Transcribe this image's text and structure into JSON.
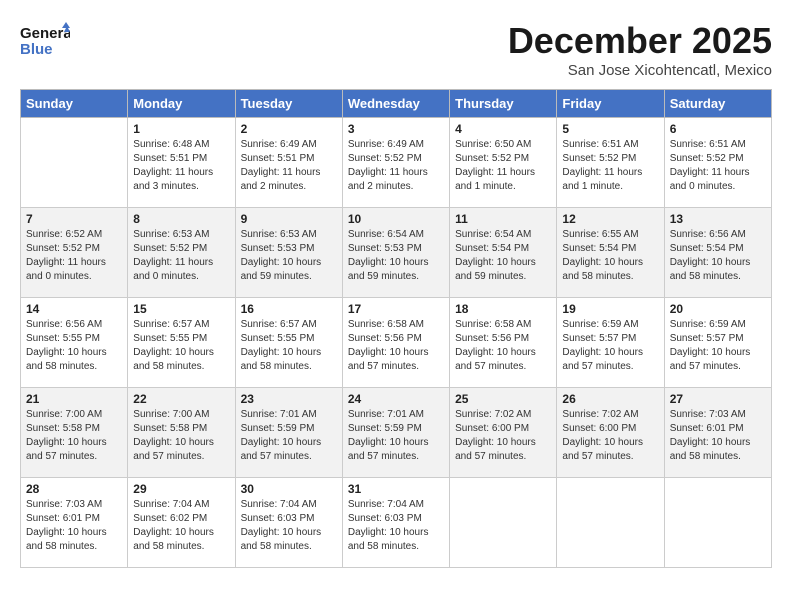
{
  "header": {
    "logo_line1": "General",
    "logo_line2": "Blue",
    "month": "December 2025",
    "location": "San Jose Xicohtencatl, Mexico"
  },
  "weekdays": [
    "Sunday",
    "Monday",
    "Tuesday",
    "Wednesday",
    "Thursday",
    "Friday",
    "Saturday"
  ],
  "weeks": [
    [
      {
        "day": "",
        "sunrise": "",
        "sunset": "",
        "daylight": ""
      },
      {
        "day": "1",
        "sunrise": "Sunrise: 6:48 AM",
        "sunset": "Sunset: 5:51 PM",
        "daylight": "Daylight: 11 hours and 3 minutes."
      },
      {
        "day": "2",
        "sunrise": "Sunrise: 6:49 AM",
        "sunset": "Sunset: 5:51 PM",
        "daylight": "Daylight: 11 hours and 2 minutes."
      },
      {
        "day": "3",
        "sunrise": "Sunrise: 6:49 AM",
        "sunset": "Sunset: 5:52 PM",
        "daylight": "Daylight: 11 hours and 2 minutes."
      },
      {
        "day": "4",
        "sunrise": "Sunrise: 6:50 AM",
        "sunset": "Sunset: 5:52 PM",
        "daylight": "Daylight: 11 hours and 1 minute."
      },
      {
        "day": "5",
        "sunrise": "Sunrise: 6:51 AM",
        "sunset": "Sunset: 5:52 PM",
        "daylight": "Daylight: 11 hours and 1 minute."
      },
      {
        "day": "6",
        "sunrise": "Sunrise: 6:51 AM",
        "sunset": "Sunset: 5:52 PM",
        "daylight": "Daylight: 11 hours and 0 minutes."
      }
    ],
    [
      {
        "day": "7",
        "sunrise": "Sunrise: 6:52 AM",
        "sunset": "Sunset: 5:52 PM",
        "daylight": "Daylight: 11 hours and 0 minutes."
      },
      {
        "day": "8",
        "sunrise": "Sunrise: 6:53 AM",
        "sunset": "Sunset: 5:52 PM",
        "daylight": "Daylight: 11 hours and 0 minutes."
      },
      {
        "day": "9",
        "sunrise": "Sunrise: 6:53 AM",
        "sunset": "Sunset: 5:53 PM",
        "daylight": "Daylight: 10 hours and 59 minutes."
      },
      {
        "day": "10",
        "sunrise": "Sunrise: 6:54 AM",
        "sunset": "Sunset: 5:53 PM",
        "daylight": "Daylight: 10 hours and 59 minutes."
      },
      {
        "day": "11",
        "sunrise": "Sunrise: 6:54 AM",
        "sunset": "Sunset: 5:54 PM",
        "daylight": "Daylight: 10 hours and 59 minutes."
      },
      {
        "day": "12",
        "sunrise": "Sunrise: 6:55 AM",
        "sunset": "Sunset: 5:54 PM",
        "daylight": "Daylight: 10 hours and 58 minutes."
      },
      {
        "day": "13",
        "sunrise": "Sunrise: 6:56 AM",
        "sunset": "Sunset: 5:54 PM",
        "daylight": "Daylight: 10 hours and 58 minutes."
      }
    ],
    [
      {
        "day": "14",
        "sunrise": "Sunrise: 6:56 AM",
        "sunset": "Sunset: 5:55 PM",
        "daylight": "Daylight: 10 hours and 58 minutes."
      },
      {
        "day": "15",
        "sunrise": "Sunrise: 6:57 AM",
        "sunset": "Sunset: 5:55 PM",
        "daylight": "Daylight: 10 hours and 58 minutes."
      },
      {
        "day": "16",
        "sunrise": "Sunrise: 6:57 AM",
        "sunset": "Sunset: 5:55 PM",
        "daylight": "Daylight: 10 hours and 58 minutes."
      },
      {
        "day": "17",
        "sunrise": "Sunrise: 6:58 AM",
        "sunset": "Sunset: 5:56 PM",
        "daylight": "Daylight: 10 hours and 57 minutes."
      },
      {
        "day": "18",
        "sunrise": "Sunrise: 6:58 AM",
        "sunset": "Sunset: 5:56 PM",
        "daylight": "Daylight: 10 hours and 57 minutes."
      },
      {
        "day": "19",
        "sunrise": "Sunrise: 6:59 AM",
        "sunset": "Sunset: 5:57 PM",
        "daylight": "Daylight: 10 hours and 57 minutes."
      },
      {
        "day": "20",
        "sunrise": "Sunrise: 6:59 AM",
        "sunset": "Sunset: 5:57 PM",
        "daylight": "Daylight: 10 hours and 57 minutes."
      }
    ],
    [
      {
        "day": "21",
        "sunrise": "Sunrise: 7:00 AM",
        "sunset": "Sunset: 5:58 PM",
        "daylight": "Daylight: 10 hours and 57 minutes."
      },
      {
        "day": "22",
        "sunrise": "Sunrise: 7:00 AM",
        "sunset": "Sunset: 5:58 PM",
        "daylight": "Daylight: 10 hours and 57 minutes."
      },
      {
        "day": "23",
        "sunrise": "Sunrise: 7:01 AM",
        "sunset": "Sunset: 5:59 PM",
        "daylight": "Daylight: 10 hours and 57 minutes."
      },
      {
        "day": "24",
        "sunrise": "Sunrise: 7:01 AM",
        "sunset": "Sunset: 5:59 PM",
        "daylight": "Daylight: 10 hours and 57 minutes."
      },
      {
        "day": "25",
        "sunrise": "Sunrise: 7:02 AM",
        "sunset": "Sunset: 6:00 PM",
        "daylight": "Daylight: 10 hours and 57 minutes."
      },
      {
        "day": "26",
        "sunrise": "Sunrise: 7:02 AM",
        "sunset": "Sunset: 6:00 PM",
        "daylight": "Daylight: 10 hours and 57 minutes."
      },
      {
        "day": "27",
        "sunrise": "Sunrise: 7:03 AM",
        "sunset": "Sunset: 6:01 PM",
        "daylight": "Daylight: 10 hours and 58 minutes."
      }
    ],
    [
      {
        "day": "28",
        "sunrise": "Sunrise: 7:03 AM",
        "sunset": "Sunset: 6:01 PM",
        "daylight": "Daylight: 10 hours and 58 minutes."
      },
      {
        "day": "29",
        "sunrise": "Sunrise: 7:04 AM",
        "sunset": "Sunset: 6:02 PM",
        "daylight": "Daylight: 10 hours and 58 minutes."
      },
      {
        "day": "30",
        "sunrise": "Sunrise: 7:04 AM",
        "sunset": "Sunset: 6:03 PM",
        "daylight": "Daylight: 10 hours and 58 minutes."
      },
      {
        "day": "31",
        "sunrise": "Sunrise: 7:04 AM",
        "sunset": "Sunset: 6:03 PM",
        "daylight": "Daylight: 10 hours and 58 minutes."
      },
      {
        "day": "",
        "sunrise": "",
        "sunset": "",
        "daylight": ""
      },
      {
        "day": "",
        "sunrise": "",
        "sunset": "",
        "daylight": ""
      },
      {
        "day": "",
        "sunrise": "",
        "sunset": "",
        "daylight": ""
      }
    ]
  ]
}
